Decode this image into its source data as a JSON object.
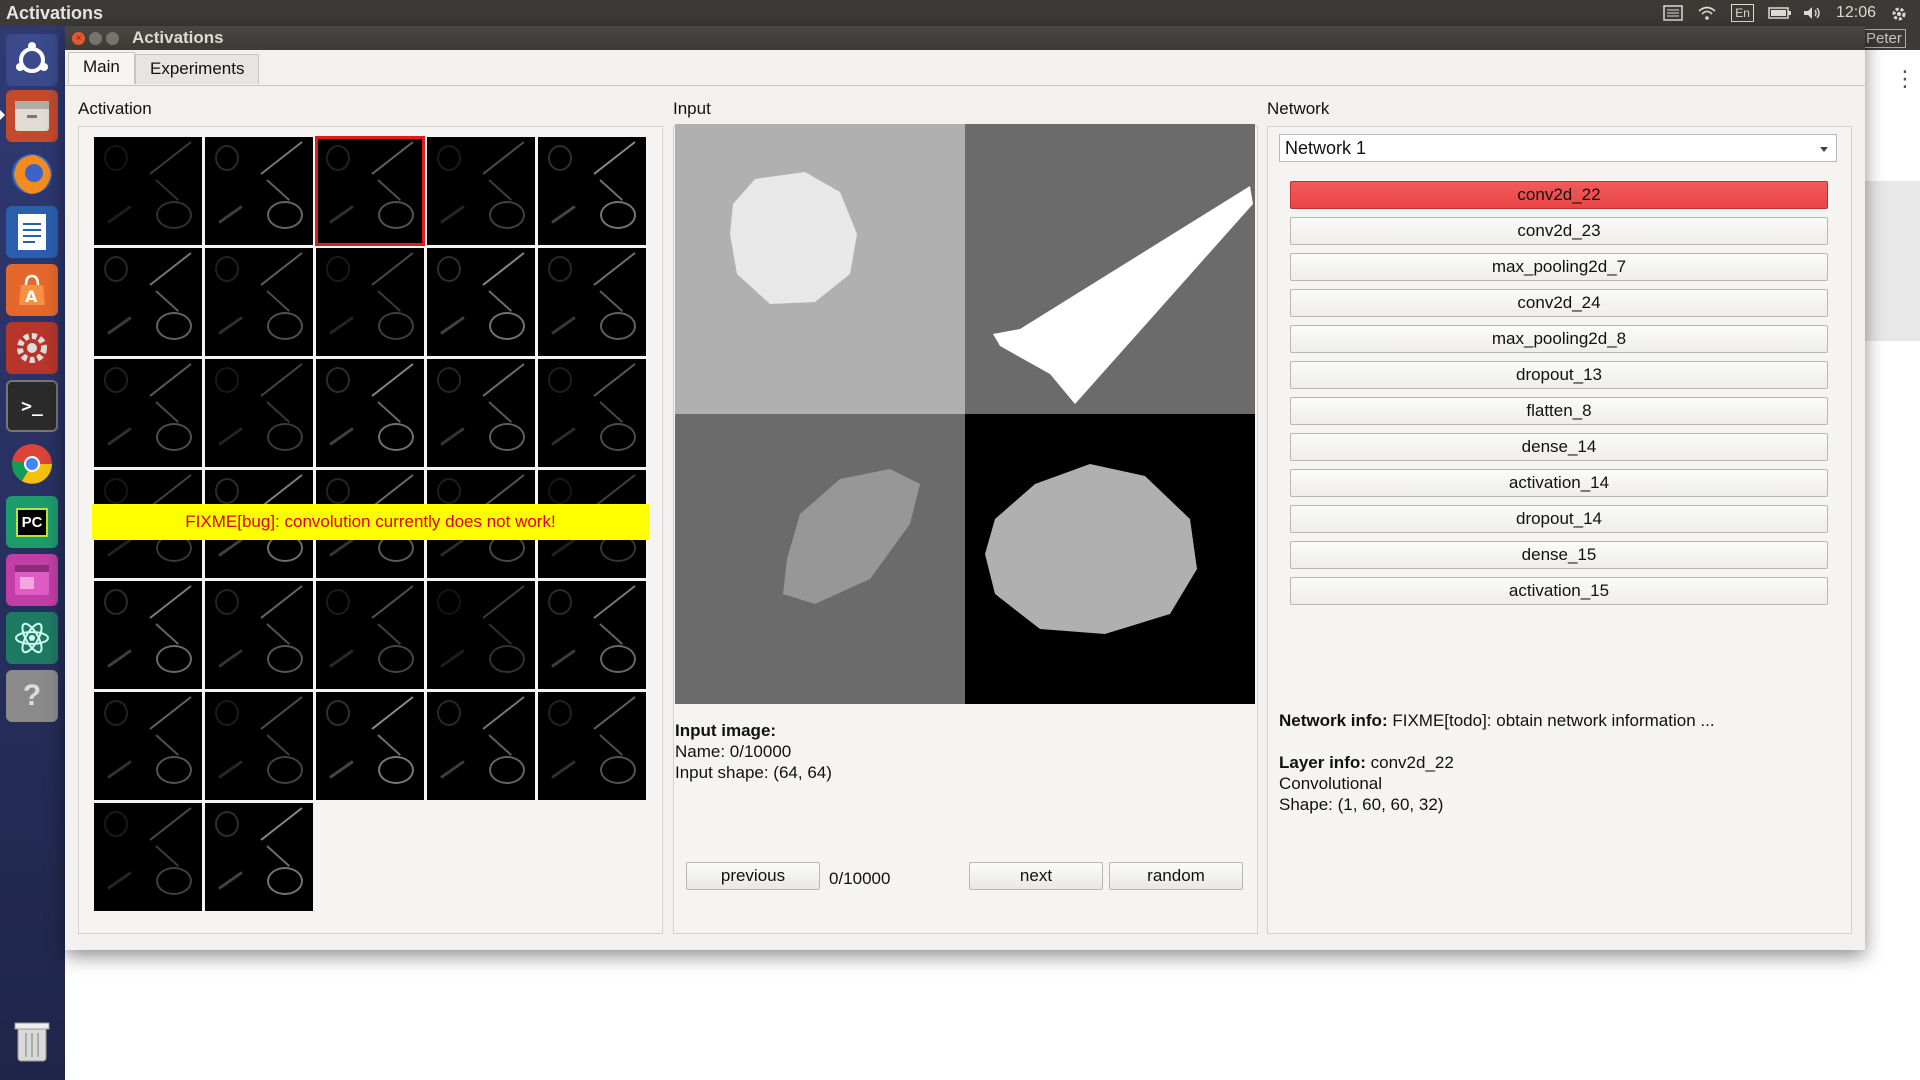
{
  "topbar": {
    "app_name": "Activations",
    "keyboard_layout": "En",
    "clock": "12:06"
  },
  "window": {
    "title": "Activations"
  },
  "tabs": [
    {
      "label": "Main",
      "active": true
    },
    {
      "label": "Experiments",
      "active": false
    }
  ],
  "activation": {
    "label": "Activation",
    "selected_index": 2,
    "cell_count": 32,
    "banner": "FIXME[bug]: convolution currently does not work!"
  },
  "input": {
    "label": "Input",
    "info_heading": "Input image:",
    "name_line": "Name: 0/10000",
    "shape_line": "Input shape: (64, 64)",
    "previous_label": "previous",
    "counter": "0/10000",
    "next_label": "next",
    "random_label": "random"
  },
  "network": {
    "label": "Network",
    "selected": "Network 1",
    "layers": [
      {
        "label": "conv2d_22",
        "active": true
      },
      {
        "label": "conv2d_23",
        "active": false
      },
      {
        "label": "max_pooling2d_7",
        "active": false
      },
      {
        "label": "conv2d_24",
        "active": false
      },
      {
        "label": "max_pooling2d_8",
        "active": false
      },
      {
        "label": "dropout_13",
        "active": false
      },
      {
        "label": "flatten_8",
        "active": false
      },
      {
        "label": "dense_14",
        "active": false
      },
      {
        "label": "activation_14",
        "active": false
      },
      {
        "label": "dropout_14",
        "active": false
      },
      {
        "label": "dense_15",
        "active": false
      },
      {
        "label": "activation_15",
        "active": false
      }
    ],
    "info_label": "Network info:",
    "info_text": " FIXME[todo]: obtain network information ...",
    "layer_info_label": "Layer info:",
    "layer_info_text": " conv2d_22",
    "layer_type": "Convolutional",
    "layer_shape": "Shape: (1, 60, 60, 32)"
  },
  "background_window": {
    "user_label": "Peter"
  },
  "colors": {
    "active_layer": "#e84545",
    "banner_bg": "#ffff00",
    "banner_text": "#e00000"
  }
}
